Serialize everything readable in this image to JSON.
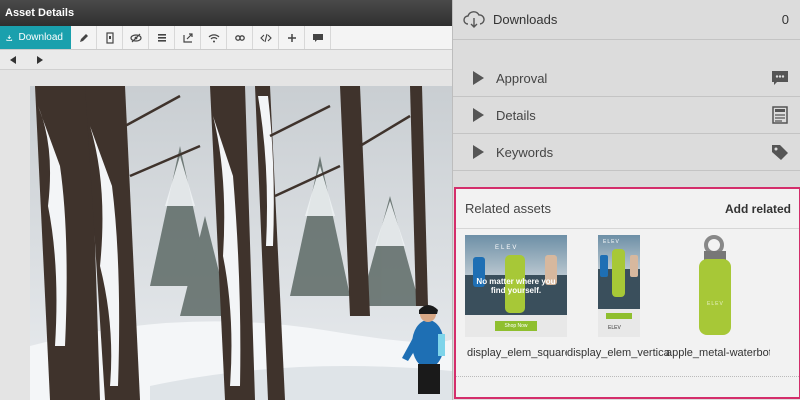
{
  "window": {
    "title": "Asset Details"
  },
  "toolbar": {
    "download_label": "Download",
    "icons": [
      "pencil-icon",
      "document-icon",
      "hide-icon",
      "list-icon",
      "share-icon",
      "wifi-icon",
      "link-icon",
      "code-icon",
      "plus-icon",
      "comment-icon"
    ]
  },
  "pager": {
    "prev_icon": "prev-arrow-icon",
    "next_icon": "next-arrow-icon"
  },
  "panel": {
    "downloads": {
      "label": "Downloads",
      "count": "0"
    },
    "sections": [
      {
        "label": "Approval",
        "icon": "comment-icon"
      },
      {
        "label": "Details",
        "icon": "details-icon"
      },
      {
        "label": "Keywords",
        "icon": "tag-icon"
      }
    ]
  },
  "related": {
    "title": "Related assets",
    "add_label": "Add related",
    "items": [
      {
        "name": "display_elem_square",
        "brand": "ELEV",
        "headline": "No matter where you find yourself.",
        "cta": "Shop Now"
      },
      {
        "name": "display_elem_vertical",
        "brand": "ELEV",
        "cta": "ELEV"
      },
      {
        "name": "apple_metal-waterbottle",
        "brand": "ELEV"
      }
    ]
  },
  "colors": {
    "accent": "#1aa0ad",
    "highlight": "#d42e6b",
    "bottle_green": "#a7c837"
  }
}
